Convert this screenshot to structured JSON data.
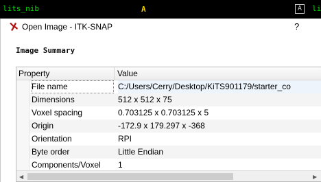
{
  "background": {
    "left_label": "lits_nib",
    "center_annotation": "A",
    "button_label": "A",
    "right_label": "li"
  },
  "dialog": {
    "title": "Open Image - ITK-SNAP",
    "help": "?",
    "section_title": "Image Summary",
    "table": {
      "columns": [
        "Property",
        "Value"
      ],
      "rows": [
        {
          "property": "File name",
          "value": "C:/Users/Cerry/Desktop/KiTS901179/starter_co"
        },
        {
          "property": "Dimensions",
          "value": "512 x 512 x 75"
        },
        {
          "property": "Voxel spacing",
          "value": "0.703125 x 0.703125 x 5"
        },
        {
          "property": "Origin",
          "value": "-172.9 x 179.297 x -368"
        },
        {
          "property": "Orientation",
          "value": "RPI"
        },
        {
          "property": "Byte order",
          "value": "Little Endian"
        },
        {
          "property": "Components/Voxel",
          "value": "1"
        }
      ]
    },
    "scrollbar": {
      "left_arrow": "◀",
      "right_arrow": "▶"
    }
  },
  "icons": {
    "app": "itk-snap-logo-icon"
  },
  "colors": {
    "overlay_label": "#00e000",
    "annotation": "#f0d000"
  }
}
